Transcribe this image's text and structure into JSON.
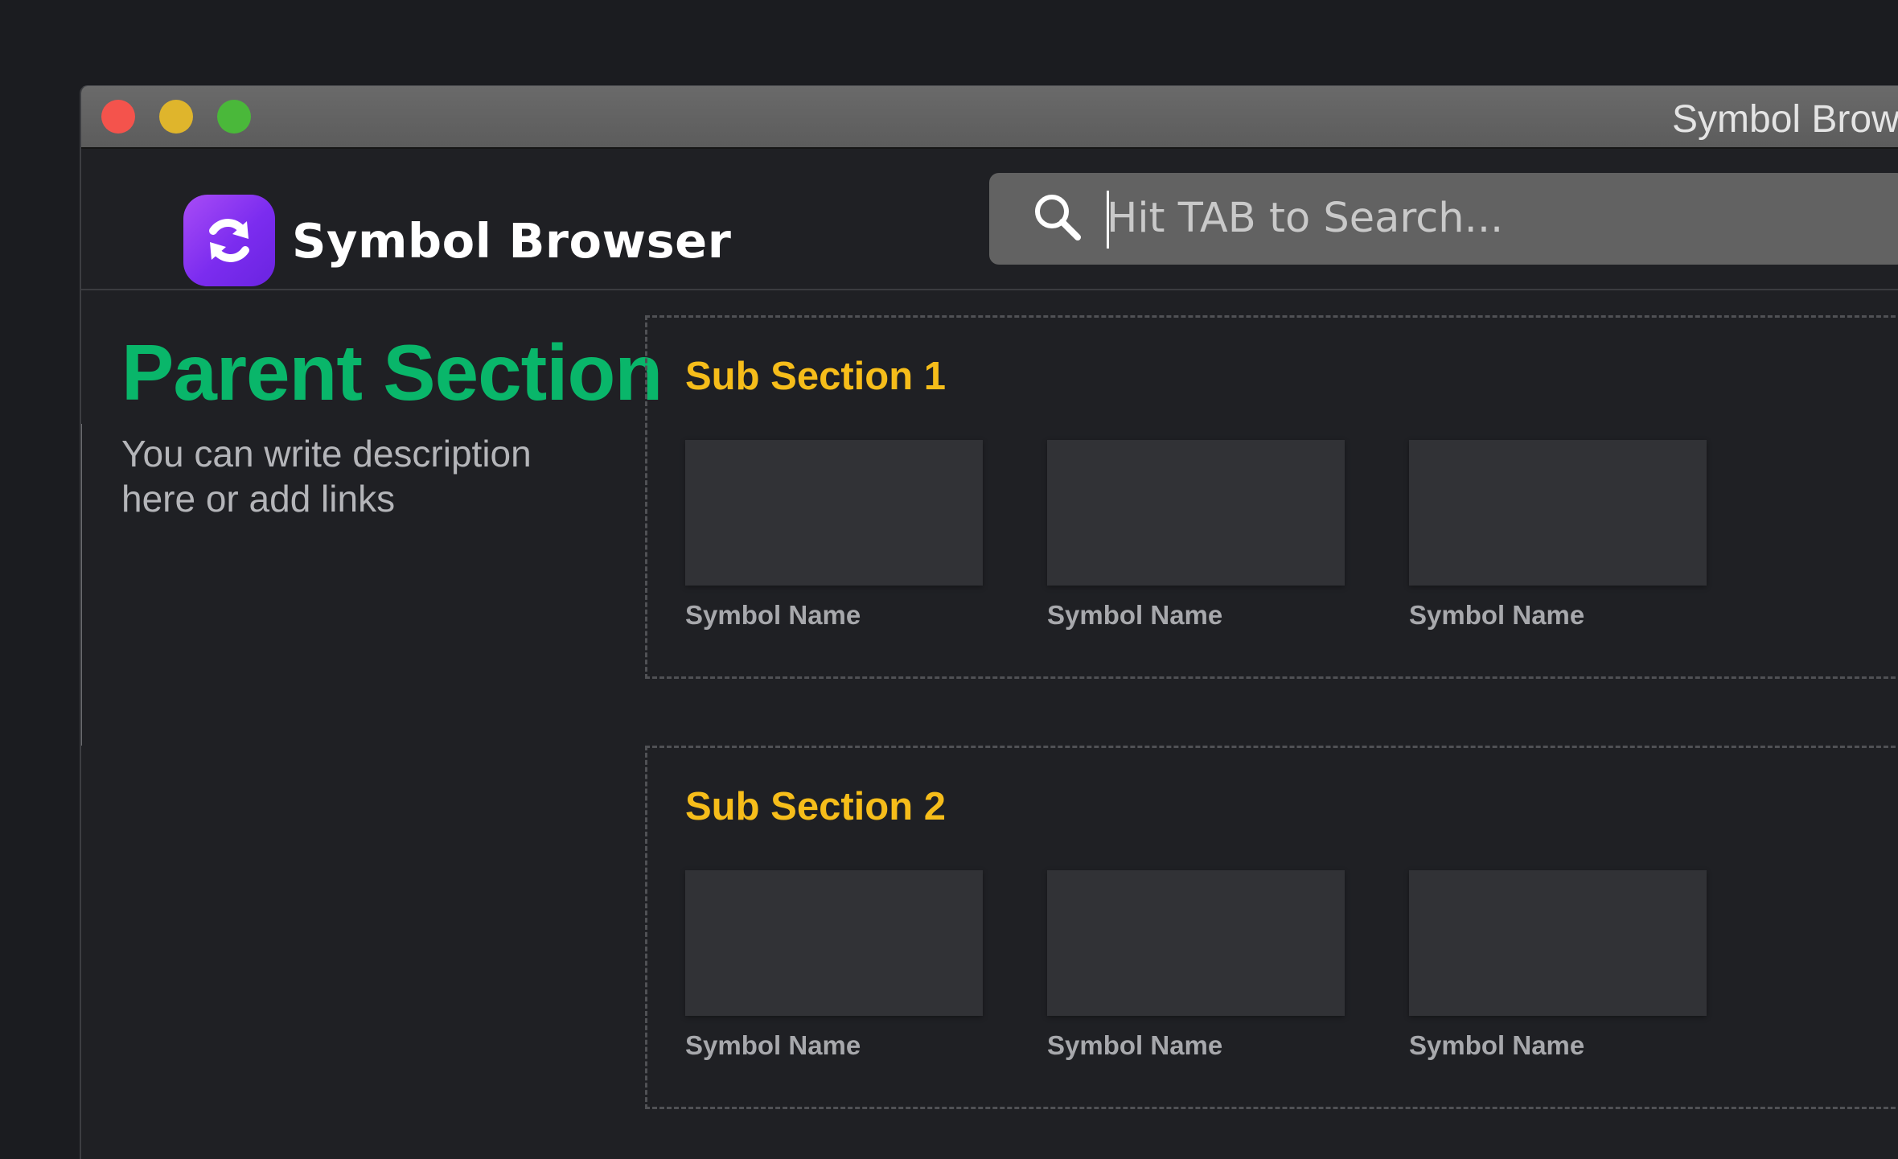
{
  "window": {
    "title": "Symbol Browser"
  },
  "header": {
    "app_name": "Symbol Browser",
    "logo_icon": "refresh-arrows-icon",
    "search": {
      "placeholder": "Hit TAB to Search...",
      "value": "",
      "icon": "search-icon"
    }
  },
  "parent_section": {
    "title": "Parent Section",
    "description": "You can write description here or add links"
  },
  "sub_sections": [
    {
      "title": "Sub Section 1",
      "symbols": [
        {
          "name": "Symbol Name"
        },
        {
          "name": "Symbol Name"
        },
        {
          "name": "Symbol Name"
        }
      ]
    },
    {
      "title": "Sub Section 2",
      "symbols": [
        {
          "name": "Symbol Name"
        },
        {
          "name": "Symbol Name"
        },
        {
          "name": "Symbol Name"
        }
      ]
    }
  ],
  "colors": {
    "background": "#1f2024",
    "parent_title": "#09b66a",
    "sub_title": "#f6bd1a",
    "symbol_thumb": "#313236",
    "logo_gradient_start": "#a84cf6",
    "logo_gradient_end": "#6a24e0",
    "close_button": "#f4534c",
    "minimize_button": "#dfb52c",
    "zoom_button": "#4ab83a"
  }
}
